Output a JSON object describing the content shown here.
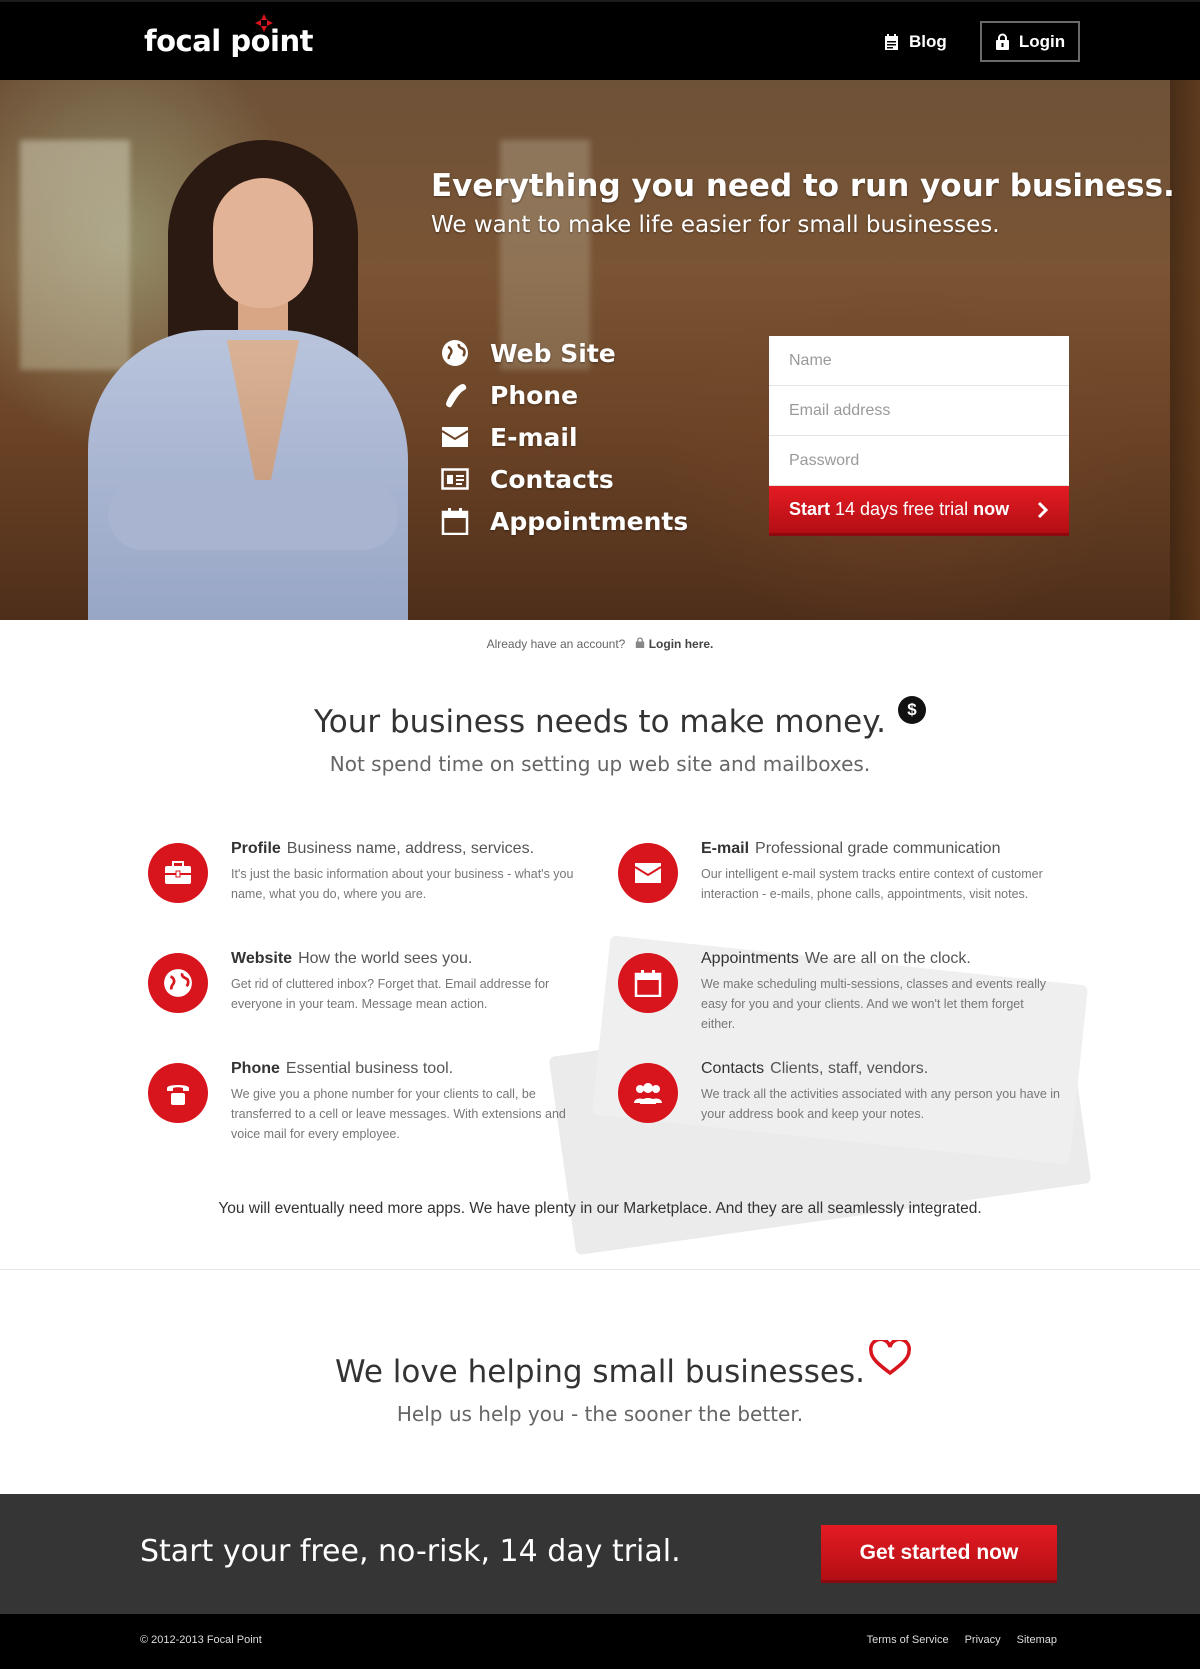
{
  "header": {
    "logo": "focal point",
    "nav": {
      "blog": "Blog",
      "login": "Login"
    }
  },
  "hero": {
    "title": "Everything you need to run your business.",
    "subtitle": "We want to make life easier for small businesses.",
    "features": [
      {
        "label": "Web Site",
        "icon": "globe-icon"
      },
      {
        "label": "Phone",
        "icon": "phone-icon"
      },
      {
        "label": "E-mail",
        "icon": "envelope-icon"
      },
      {
        "label": "Contacts",
        "icon": "contact-card-icon"
      },
      {
        "label": "Appointments",
        "icon": "calendar-icon"
      }
    ],
    "form": {
      "name_placeholder": "Name",
      "email_placeholder": "Email address",
      "password_placeholder": "Password",
      "button": {
        "start": "Start",
        "middle": " 14 days free trial ",
        "now": "now"
      }
    }
  },
  "account": {
    "question": "Already have an account?",
    "link": "Login here."
  },
  "money": {
    "title": "Your business needs to make money.",
    "subtitle": "Not spend time on setting up web site and mailboxes.",
    "items": [
      {
        "title": "Profile",
        "tagline": "Business name, address, services.",
        "desc": "It's just the basic information about your business - what's you name, what you do, where you are.",
        "icon": "briefcase-icon"
      },
      {
        "title": "E-mail",
        "tagline": "Professional grade communication",
        "desc": "Our intelligent e-mail system tracks entire context of customer interaction - e-mails, phone calls, appointments, visit notes.",
        "icon": "envelope-icon"
      },
      {
        "title": "Website",
        "tagline": "How the world sees you.",
        "desc": "Get rid of cluttered inbox? Forget that. Email addresse for everyone in your team. Message mean action.",
        "icon": "globe-icon"
      },
      {
        "title": "Appointments",
        "tagline": "We are all on the clock.",
        "desc": "We make scheduling multi-sessions, classes and events really easy for you and your clients. And we won't let them forget either.",
        "icon": "calendar-icon"
      },
      {
        "title": "Phone",
        "tagline": "Essential business tool.",
        "desc": "We give you a phone number for your clients to call, be transferred to a cell or leave messages. With extensions and voice mail for every employee.",
        "icon": "telephone-icon"
      },
      {
        "title": "Contacts",
        "tagline": "Clients, staff, vendors.",
        "desc": "We track all the activities associated with any person you have in your address book and keep your notes.",
        "icon": "people-icon"
      }
    ],
    "marketplace": "You will eventually need more apps. We have plenty in our Marketplace. And they are all seamlessly integrated."
  },
  "love": {
    "title": "We love helping small businesses.",
    "subtitle": "Help us help you - the sooner the better."
  },
  "cta": {
    "text": "Start your free, no-risk, 14 day trial.",
    "button": "Get started now"
  },
  "footer": {
    "copyright": "©  2012-2013 Focal Point",
    "links": [
      "Terms of Service",
      "Privacy",
      "Sitemap"
    ]
  },
  "colors": {
    "accent": "#d8141d",
    "header": "#000000",
    "cta_band": "#353535"
  }
}
